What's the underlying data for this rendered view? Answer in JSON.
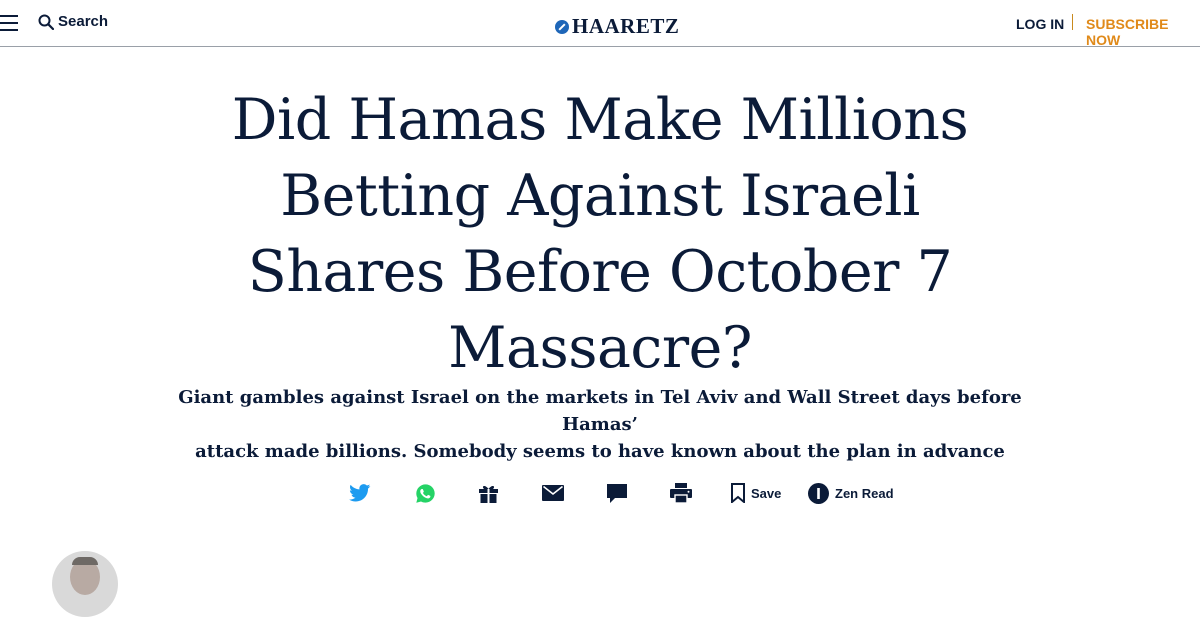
{
  "header": {
    "search_label": "Search",
    "logo_text": "HAARETZ",
    "login_label": "LOG IN",
    "subscribe_label": "SUBSCRIBE NOW"
  },
  "article": {
    "headline_lines": [
      "Did Hamas Make Millions",
      "Betting Against Israeli",
      "Shares Before October 7",
      "Massacre?"
    ],
    "dek_lines": [
      "Giant gambles against Israel on the markets in Tel Aviv and Wall Street days before Hamas’",
      "attack made billions. Somebody seems to have known about the plan in advance"
    ]
  },
  "share_bar": {
    "save_label": "Save",
    "zen_label": "Zen Read"
  },
  "colors": {
    "text": "#0b1b38",
    "accent_subscribe": "#e08a1a",
    "twitter": "#1d9bf0",
    "whatsapp": "#25d366"
  },
  "icons": [
    "hamburger-icon",
    "search-icon",
    "twitter-icon",
    "whatsapp-icon",
    "gift-icon",
    "mail-icon",
    "comment-icon",
    "print-icon",
    "bookmark-icon",
    "zen-read-icon"
  ]
}
